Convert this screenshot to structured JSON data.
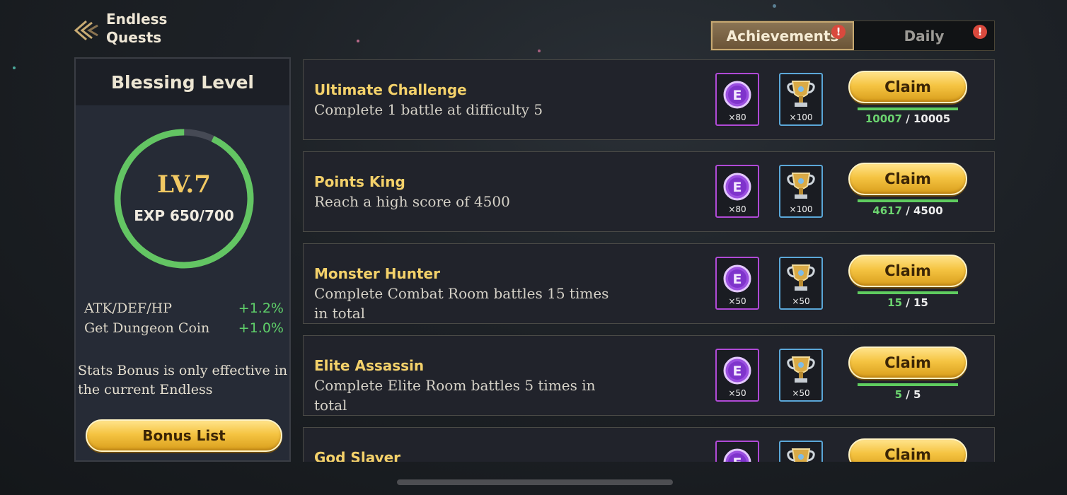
{
  "header": {
    "title_line1": "Endless",
    "title_line2": "Quests"
  },
  "tabs": [
    {
      "label": "Achievements",
      "active": true,
      "alert": "!"
    },
    {
      "label": "Daily",
      "active": false,
      "alert": "!"
    }
  ],
  "blessing": {
    "title": "Blessing Level",
    "level": "LV.7",
    "exp": "EXP 650/700",
    "exp_fraction": 0.929,
    "stats": [
      {
        "label": "ATK/DEF/HP",
        "value": "+1.2%"
      },
      {
        "label": "Get Dungeon Coin",
        "value": "+1.0%"
      }
    ],
    "note": "Stats Bonus is only effective in the current Endless",
    "bonus_button": "Bonus List"
  },
  "quests": [
    {
      "name": "Ultimate Challenge",
      "desc": "Complete 1 battle at difficulty 5",
      "coin": "×80",
      "trophy": "×100",
      "claim": "Claim",
      "current": "10007",
      "target": "/ 10005"
    },
    {
      "name": "Points King",
      "desc": "Reach a high score of 4500",
      "coin": "×80",
      "trophy": "×100",
      "claim": "Claim",
      "current": "4617",
      "target": "/ 4500"
    },
    {
      "name": "Monster Hunter",
      "desc": "Complete Combat Room battles 15 times in total",
      "coin": "×50",
      "trophy": "×50",
      "claim": "Claim",
      "current": "15",
      "target": "/ 15"
    },
    {
      "name": "Elite Assassin",
      "desc": "Complete Elite Room battles 5 times in total",
      "coin": "×50",
      "trophy": "×50",
      "claim": "Claim",
      "current": "5",
      "target": "/ 5"
    },
    {
      "name": "God Slayer",
      "desc": "",
      "coin": "",
      "trophy": "",
      "claim": "Claim",
      "current": "",
      "target": ""
    }
  ],
  "colors": {
    "accent_gold": "#f4d16a",
    "progress_green": "#5fcc5f",
    "alert_red": "#d9493d",
    "coin_border": "#b04ad6",
    "trophy_border": "#5ba7d8"
  },
  "icons": {
    "back": "chevron-left-icon",
    "coin": "e-coin-icon",
    "trophy": "trophy-icon"
  }
}
